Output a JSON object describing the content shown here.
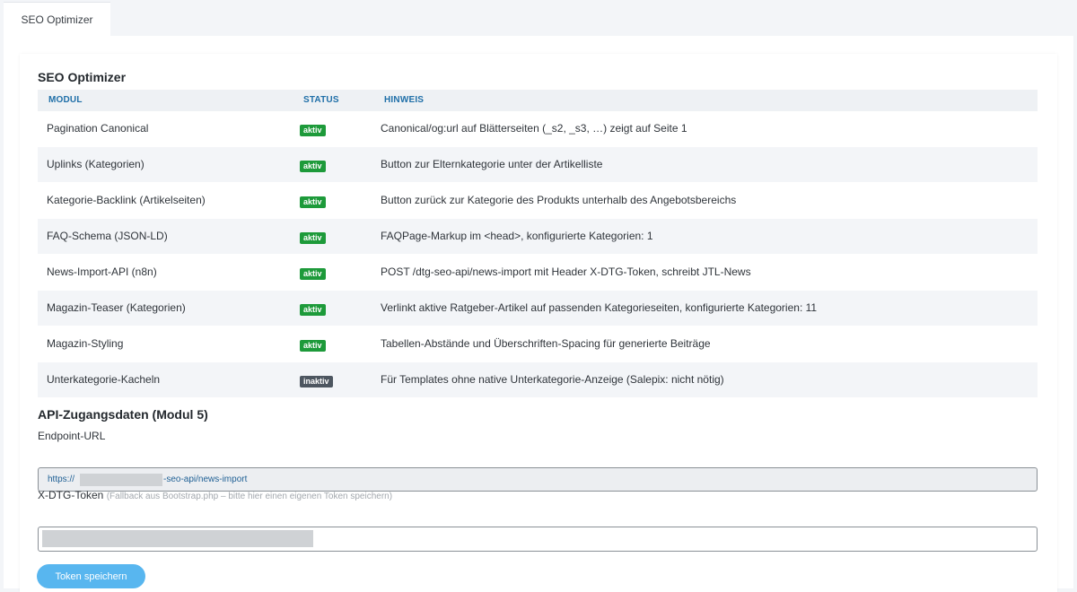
{
  "tab": {
    "label": "SEO Optimizer"
  },
  "section": {
    "title": "SEO Optimizer"
  },
  "table": {
    "headers": {
      "modul": "MODUL",
      "status": "STATUS",
      "hinweis": "HINWEIS"
    },
    "rows": [
      {
        "modul": "Pagination Canonical",
        "status": "aktiv",
        "hinweis": "Canonical/og:url auf Blätterseiten (_s2, _s3, …) zeigt auf Seite 1"
      },
      {
        "modul": "Uplinks (Kategorien)",
        "status": "aktiv",
        "hinweis": "Button zur Elternkategorie unter der Artikelliste"
      },
      {
        "modul": "Kategorie-Backlink (Artikelseiten)",
        "status": "aktiv",
        "hinweis": "Button zurück zur Kategorie des Produkts unterhalb des Angebotsbereichs"
      },
      {
        "modul": "FAQ-Schema (JSON-LD)",
        "status": "aktiv",
        "hinweis": "FAQPage-Markup im <head>, konfigurierte Kategorien: 1"
      },
      {
        "modul": "News-Import-API (n8n)",
        "status": "aktiv",
        "hinweis": "POST /dtg-seo-api/news-import mit Header X-DTG-Token, schreibt JTL-News"
      },
      {
        "modul": "Magazin-Teaser (Kategorien)",
        "status": "aktiv",
        "hinweis": "Verlinkt aktive Ratgeber-Artikel auf passenden Kategorieseiten, konfigurierte Kategorien: 11"
      },
      {
        "modul": "Magazin-Styling",
        "status": "aktiv",
        "hinweis": "Tabellen-Abstände und Überschriften-Spacing für generierte Beiträge"
      },
      {
        "modul": "Unterkategorie-Kacheln",
        "status": "inaktiv",
        "hinweis": "Für Templates ohne native Unterkategorie-Anzeige (Salepix: nicht nötig)"
      }
    ]
  },
  "api": {
    "title": "API-Zugangsdaten (Modul 5)",
    "endpoint_label": "Endpoint-URL",
    "endpoint_prefix": "https://",
    "endpoint_suffix": "-seo-api/news-import",
    "token_label": "X-DTG-Token",
    "token_hint": "(Fallback aus Bootstrap.php – bitte hier einen eigenen Token speichern)",
    "save_button": "Token speichern"
  },
  "colors": {
    "active_badge": "#1d9a3a",
    "inactive_badge": "#4d5660",
    "button": "#58b6ef",
    "header_text": "#1f6fa8"
  }
}
